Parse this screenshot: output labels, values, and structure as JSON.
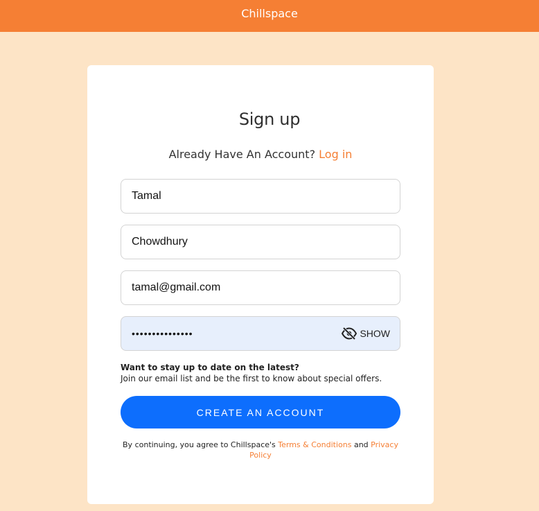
{
  "header": {
    "brand": "Chillspace"
  },
  "form": {
    "title": "Sign up",
    "have_account_text": "Already Have An Account?",
    "login_link": "Log in",
    "first_name": {
      "value": "Tamal"
    },
    "last_name": {
      "value": "Chowdhury"
    },
    "email": {
      "value": "tamal@gmail.com"
    },
    "password": {
      "value": "•••••••••••••••",
      "toggle_label": "SHOW",
      "toggle_icon": "eye-slash-icon"
    },
    "promo_heading": "Want to stay up to date on the latest?",
    "promo_text": "Join our email list and be the first to know about special offers.",
    "submit_label": "CREATE AN ACCOUNT",
    "legal_prefix": "By continuing, you agree to Chillspace's",
    "terms_link": "Terms & Conditions",
    "legal_and": "and",
    "privacy_link": "Privacy Policy"
  },
  "colors": {
    "accent": "#f57f34",
    "background": "#fde4c6",
    "primary_button": "#0d6efd",
    "password_field_bg": "#e7effc"
  }
}
